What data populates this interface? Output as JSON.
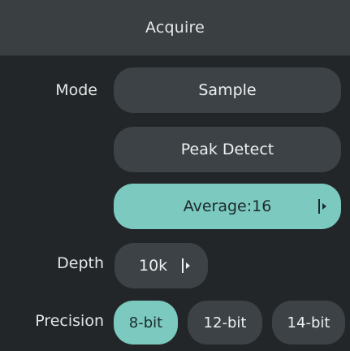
{
  "header": {
    "title": "Acquire"
  },
  "mode": {
    "label": "Mode",
    "options": [
      {
        "label": "Sample",
        "selected": false
      },
      {
        "label": "Peak Detect",
        "selected": false
      },
      {
        "label": "Average:16",
        "selected": true
      }
    ]
  },
  "depth": {
    "label": "Depth",
    "value": "10k"
  },
  "precision": {
    "label": "Precision",
    "options": [
      {
        "label": "8-bit",
        "selected": true
      },
      {
        "label": "12-bit",
        "selected": false
      },
      {
        "label": "14-bit",
        "selected": false
      }
    ]
  },
  "colors": {
    "background": "#232628",
    "header": "#3a3f42",
    "pill": "#3c4245",
    "accent": "#7cc9c0"
  },
  "icons": {
    "expand": "expand-right-icon"
  }
}
